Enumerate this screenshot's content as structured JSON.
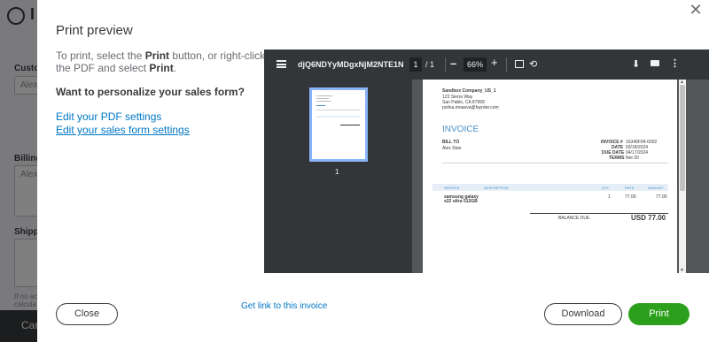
{
  "background": {
    "header_fragment": "I",
    "customer_label": "Custo",
    "customer_value": "Alex",
    "billing_label": "Billing",
    "billing_value": "Alex",
    "shipping_label": "Shipp",
    "note_line1": "If no ac",
    "note_line2": "calcula",
    "footer_button": "Can"
  },
  "modal": {
    "title": "Print preview",
    "instructions": {
      "part1": "To print, select the ",
      "print_word": "Print",
      "part2": " button, or right-click the PDF and select ",
      "print_word2": "Print",
      "part3": "."
    },
    "personalize_heading": "Want to personalize your sales form?",
    "links": {
      "pdf_settings": "Edit your PDF settings",
      "form_settings": "Edit your sales form settings",
      "get_link": "Get link to this invoice"
    },
    "buttons": {
      "close": "Close",
      "download": "Download",
      "print": "Print"
    }
  },
  "pdf_viewer": {
    "filename": "djQ6NDYyMDgxNjM2NTE1NDE...",
    "page_current": "1",
    "page_total": "/ 1",
    "zoom": "66%",
    "thumbnail_page_number": "1",
    "icons": [
      "menu-icon",
      "zoom-out-icon",
      "zoom-in-icon",
      "fit-page-icon",
      "rotate-icon",
      "download-icon",
      "print-icon",
      "more-icon"
    ]
  },
  "invoice": {
    "company": "Sandbox Company_US_1",
    "address1": "123 Sierra Way",
    "address2": "San Pablo, CA  87999",
    "email": "polina.mnaeva@fayrder.com",
    "heading": "INVOICE",
    "bill_to_label": "BILL TO",
    "bill_to_name": "Alex Stan",
    "invoice_no_label": "INVOICE #",
    "invoice_no": "16346F84-0002",
    "date_label": "DATE",
    "date": "03/18/2024",
    "due_label": "DUE DATE",
    "due": "04/17/2024",
    "terms_label": "TERMS",
    "terms": "Net 30",
    "columns": [
      "SERVICE",
      "DESCRIPTION",
      "QTY",
      "RATE",
      "AMOUNT"
    ],
    "line_item": {
      "service_line1": "samsung galaxy",
      "service_line2": "s22 ultra 512GB",
      "qty": "1",
      "rate": "77.00",
      "amount": "77.00"
    },
    "balance_label": "BALANCE DUE",
    "balance": "USD 77.00"
  },
  "colors": {
    "link": "#0077c5",
    "print_button": "#2ca01c",
    "invoice_accent": "#4a90c8"
  }
}
